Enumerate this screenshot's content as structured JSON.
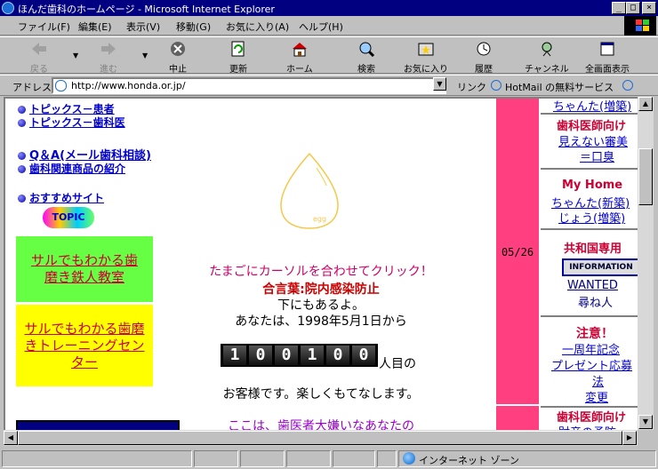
{
  "window": {
    "title": "ほんだ歯科のホームページ - Microsoft Internet Explorer",
    "min_label": "_",
    "max_label": "□",
    "close_label": "×"
  },
  "menu": [
    "ファイル(F)",
    "編集(E)",
    "表示(V)",
    "移動(G)",
    "お気に入り(A)",
    "ヘルプ(H)"
  ],
  "toolbar": {
    "back": "戻る",
    "forward": "進む",
    "stop": "中止",
    "refresh": "更新",
    "home": "ホーム",
    "search": "検索",
    "favorites": "お気に入り",
    "history": "履歴",
    "channels": "チャンネル",
    "fullscreen": "全画面表示"
  },
  "address": {
    "label": "アドレス",
    "url": "http://www.honda.or.jp/",
    "links_label": "リンク",
    "link1": "HotMail の無料サービス"
  },
  "left_nav": {
    "topics_patient": "トピックス－患者",
    "topics_dental": "トピックス－歯科医",
    "qa": "Q＆A(メール歯科相談)",
    "products": "歯科関連商品の紹介",
    "recommended": "おすすめサイト",
    "topic_badge": "TOPIC",
    "green_box": "サルでもわかる歯磨き鉄人教室",
    "yellow_box": "サルでもわかる歯磨きトレーニングセンター"
  },
  "center": {
    "egg_label": "egg",
    "line1": "たまごにカーソルを合わせてクリック！",
    "line2": "合言葉:院内感染防止",
    "line3": "下にもあるよ。",
    "line4": "あなたは、1998年5月1日から",
    "counter": [
      "1",
      "0",
      "0",
      "1",
      "0",
      "0"
    ],
    "line5_suffix": "人目の",
    "line6": "お客様です。楽しくもてなします。",
    "line7": "ここは、歯医者大嫌いなあなたの"
  },
  "date_strip": {
    "date": "05/26"
  },
  "right_col": {
    "item0": "ちゃんた(増築)",
    "item1_title": "歯科医師向け",
    "item1_link": "見えない審美",
    "item1_link2": "＝口臭",
    "item2_title": "My Home",
    "item2_link": "ちゃんた(新築)",
    "item2_link2": "じょう(増築)",
    "item3_title": "共和国専用",
    "item3_badge": "INFORMATION",
    "item3_link": "WANTED",
    "item3_link2": "尋ね人",
    "item4_title": "注意！",
    "item4_link": "一周年記念",
    "item4_link2": "プレゼント応募",
    "item4_link3": "法",
    "item4_link4": "変更",
    "item5_title": "歯科医師向け",
    "item5_link": "財産の予防"
  },
  "status": {
    "zone": "インターネット ゾーン"
  },
  "colors": {
    "titlebar": "#000080",
    "link": "#0000cc",
    "pink_strip": "#ff3f7f",
    "green_box": "#66ff44",
    "yellow_box": "#ffff00",
    "red_text": "#cc0033"
  }
}
